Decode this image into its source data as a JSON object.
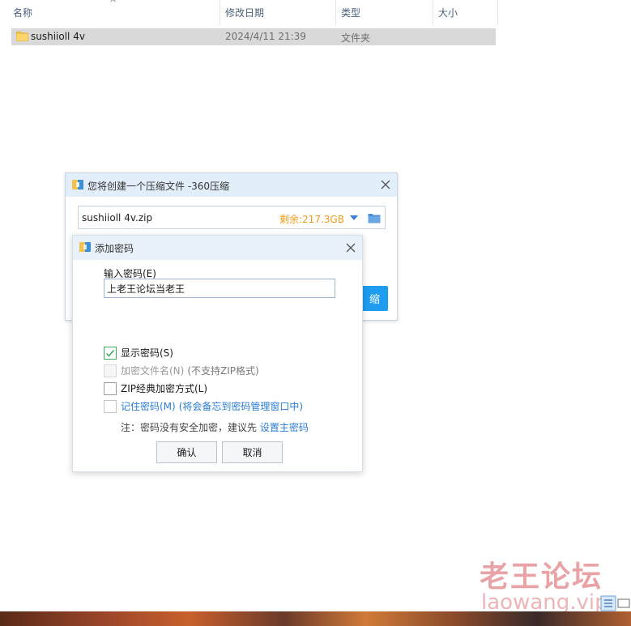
{
  "explorer": {
    "columns": {
      "name": "名称",
      "modified": "修改日期",
      "type": "类型",
      "size": "大小"
    },
    "sort_indicator": "^",
    "rows": [
      {
        "name": "sushiioll 4v",
        "modified": "2024/4/11 21:39",
        "type": "文件夹",
        "size": ""
      }
    ]
  },
  "zip_dialog": {
    "title": "您将创建一个压缩文件 -360压缩",
    "path": "sushiioll 4v.zip",
    "free_space": "剩余:217.3GB",
    "start_button": "缩"
  },
  "password_dialog": {
    "title": "添加密码",
    "input_label": "输入密码(E)",
    "password_value": "上老王论坛当老王",
    "options": [
      {
        "label": "显示密码(S)",
        "note": "",
        "checked": true,
        "disabled": false,
        "style": "normal"
      },
      {
        "label": "加密文件名(N)",
        "note": "(不支持ZIP格式)",
        "checked": false,
        "disabled": true,
        "style": "dim"
      },
      {
        "label": "ZIP经典加密方式(L)",
        "note": "",
        "checked": false,
        "disabled": false,
        "style": "normal"
      },
      {
        "label": "记住密码(M)",
        "note": "(将会备忘到密码管理窗口中)",
        "checked": false,
        "disabled": false,
        "style": "blue"
      }
    ],
    "note_prefix": "注：密码没有安全加密，建议先 ",
    "note_link": "设置主密码",
    "ok_button": "确认",
    "cancel_button": "取消"
  },
  "watermark": {
    "chinese": "老王论坛",
    "url": "laowang.vip"
  },
  "colors": {
    "accent_blue": "#1e9cf0",
    "free_space_orange": "#f09a1a",
    "link_blue": "#2a7cd2",
    "check_green": "#3aaa5e",
    "selection_gray": "#d9d9d9"
  }
}
